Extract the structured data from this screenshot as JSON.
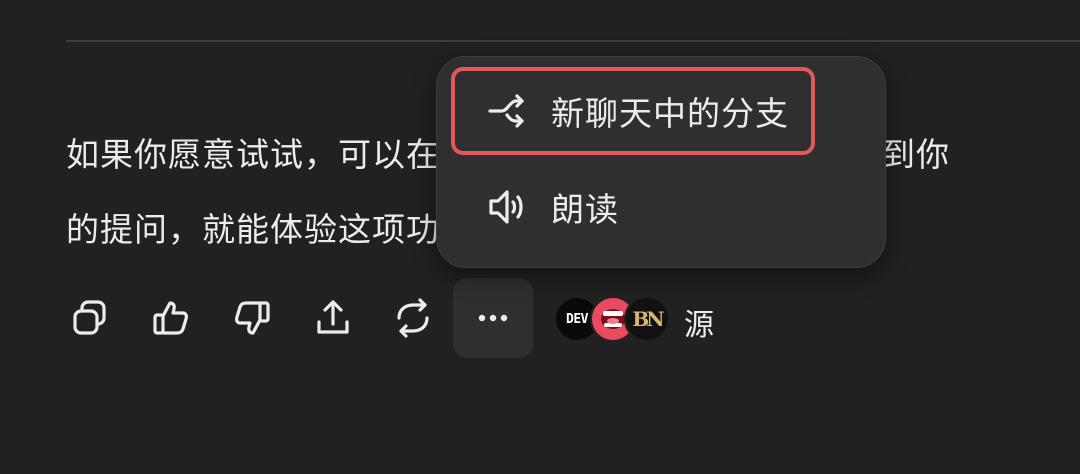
{
  "message": {
    "line1": "如果你愿意试试，可以在旧对话里通过上方操作菜单找到你",
    "line2": "的提问，就能体验这项功能，挑一个点分支看看"
  },
  "toolbar": {
    "copy": "copy",
    "like": "thumbs-up",
    "dislike": "thumbs-down",
    "share": "share",
    "regenerate": "regenerate",
    "more": "more"
  },
  "sources": {
    "label": "源",
    "items": [
      {
        "icon": "dev-logo",
        "text": "DEV"
      },
      {
        "icon": "mouth-logo",
        "text": ""
      },
      {
        "icon": "bn-logo",
        "text": "BN"
      }
    ]
  },
  "popup_menu": {
    "items": [
      {
        "label": "新聊天中的分支",
        "icon": "branch-icon",
        "highlighted": true
      },
      {
        "label": "朗读",
        "icon": "speaker-icon",
        "highlighted": false
      }
    ],
    "highlight_color": "#e05a5a"
  }
}
